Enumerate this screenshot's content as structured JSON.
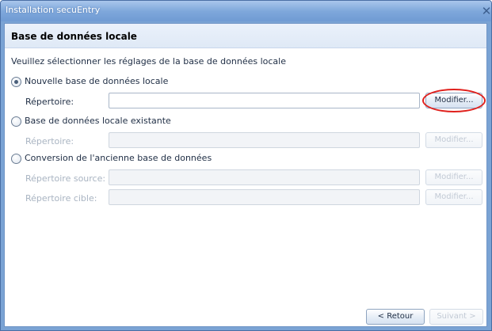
{
  "window": {
    "title": "Installation secuEntry",
    "close_glyph": "✕"
  },
  "page": {
    "title": "Base de données locale",
    "subtitle": "Veuillez sélectionner les réglages de la base de données locale"
  },
  "options": [
    {
      "label": "Nouvelle base de données locale",
      "checked": true,
      "fields": [
        {
          "label": "Répertoire:",
          "value": "",
          "button": "Modifier...",
          "enabled": true
        }
      ]
    },
    {
      "label": "Base de données locale existante",
      "checked": false,
      "fields": [
        {
          "label": "Répertoire:",
          "value": "",
          "button": "Modifier...",
          "enabled": false
        }
      ]
    },
    {
      "label": "Conversion de l'ancienne base de données",
      "checked": false,
      "fields": [
        {
          "label": "Répertoire source:",
          "value": "",
          "button": "Modifier...",
          "enabled": false
        },
        {
          "label": "Répertoire cible:",
          "value": "",
          "button": "Modifier...",
          "enabled": false
        }
      ]
    }
  ],
  "footer": {
    "back_label": "< Retour",
    "next_label": "Suivant >"
  },
  "colors": {
    "highlight": "#e0201c",
    "title_gradient": "#7fa8db"
  }
}
